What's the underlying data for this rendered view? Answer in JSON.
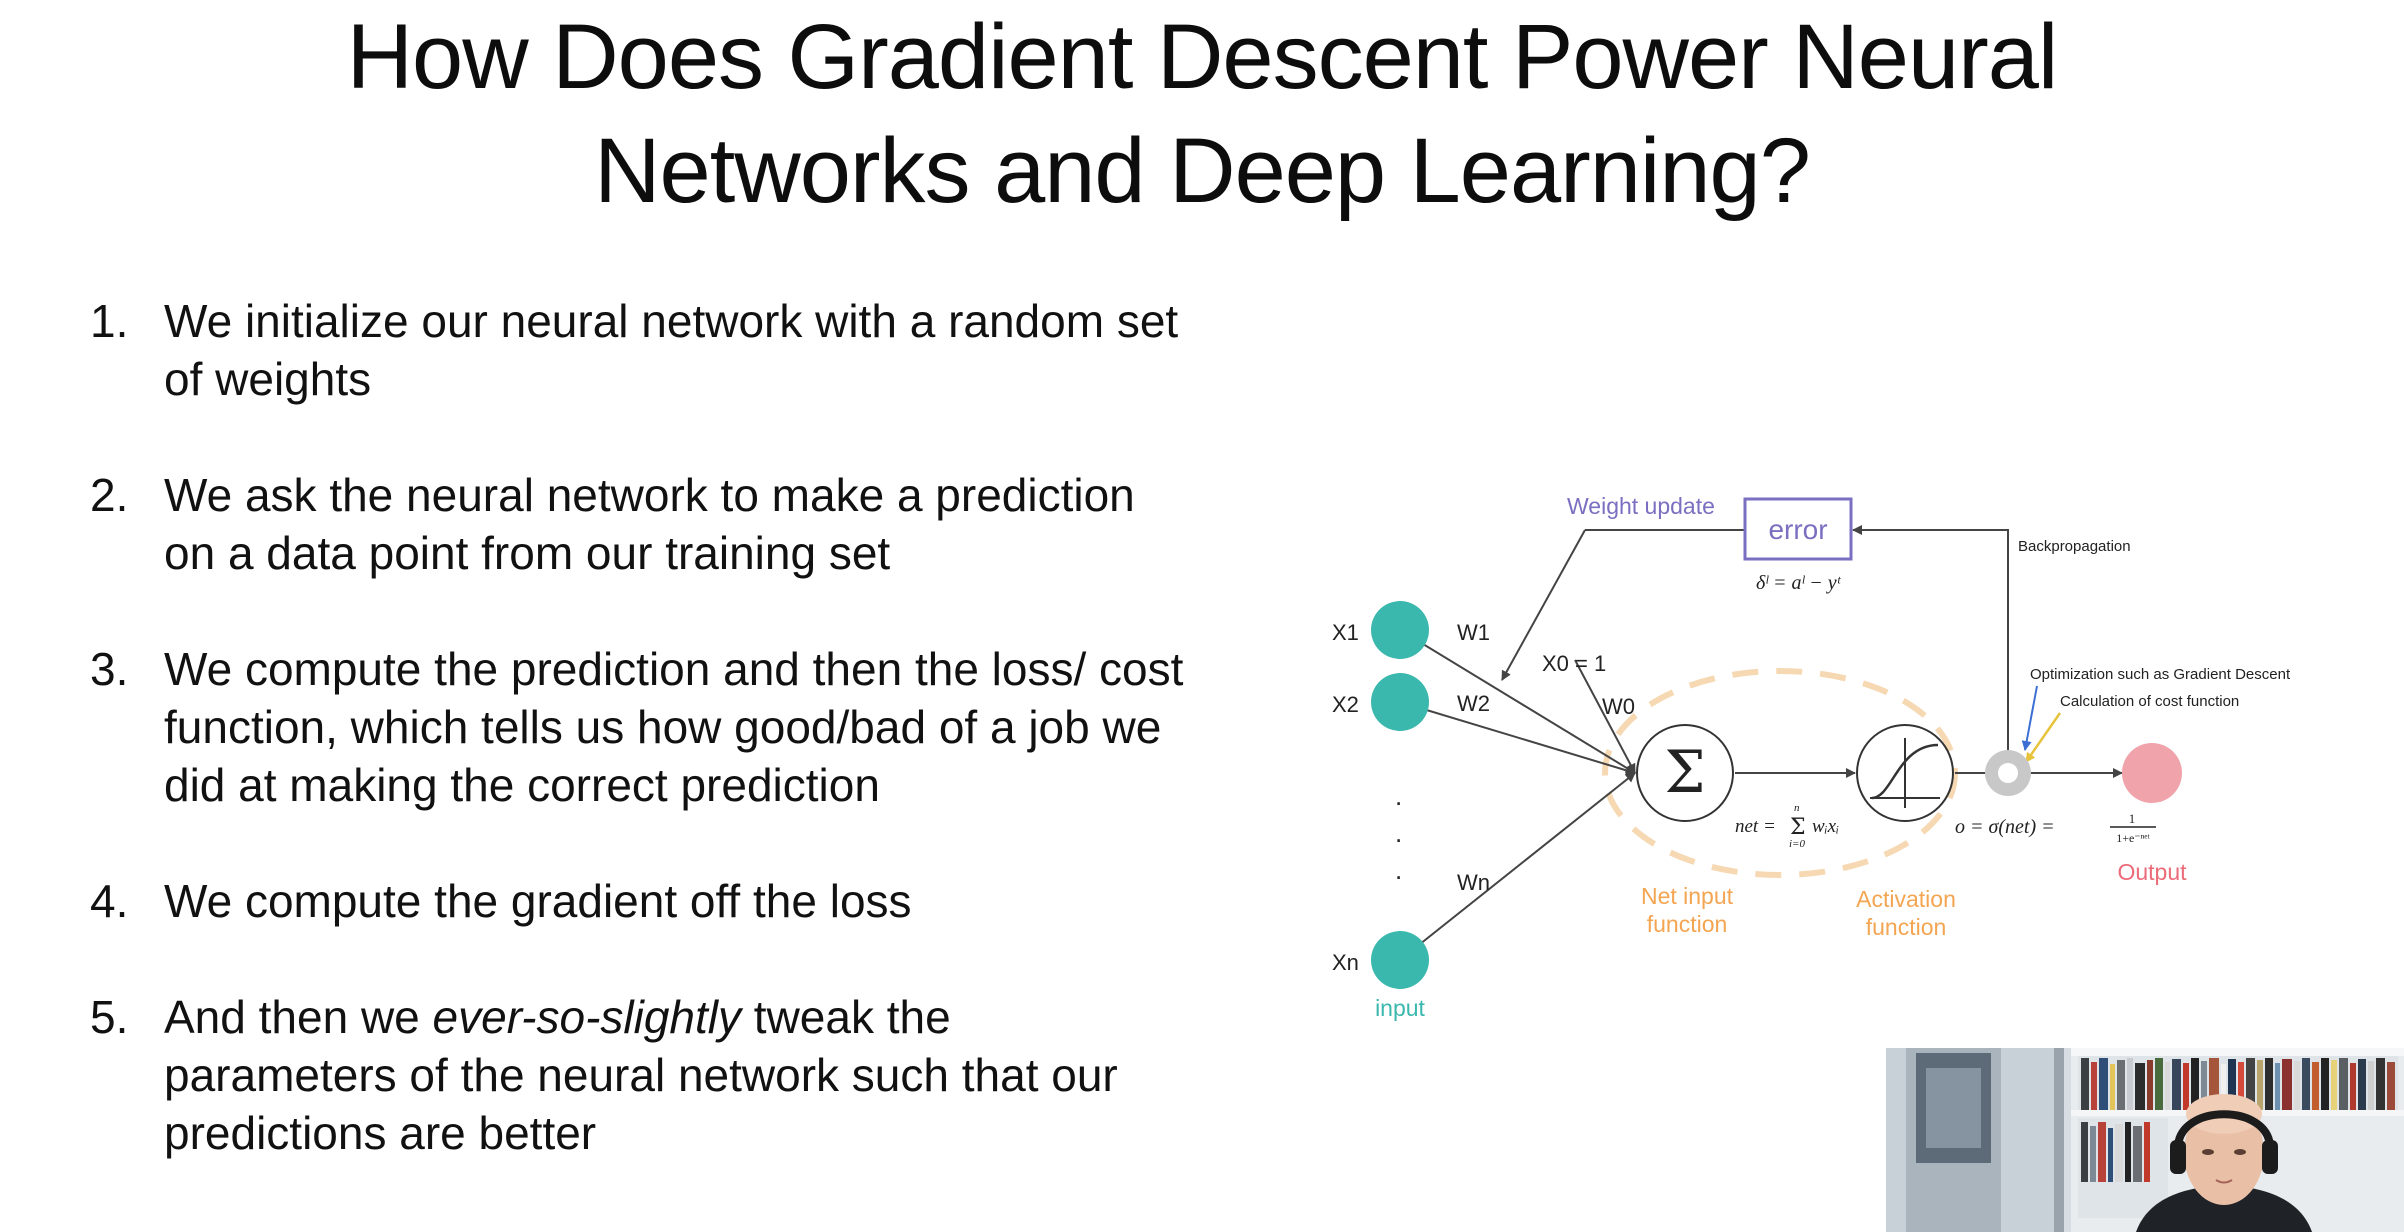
{
  "title": {
    "line1": "How Does Gradient Descent Power Neural",
    "line2": "Networks and Deep Learning?"
  },
  "steps": [
    {
      "number": "1.",
      "text": "We initialize our neural network with a random set of weights"
    },
    {
      "number": "2.",
      "text": "We ask the neural network to make a prediction on a data point from our training set"
    },
    {
      "number": "3.",
      "text": "We compute the prediction and then the loss/ cost function, which tells us how good/bad of a job we did at making the correct prediction"
    },
    {
      "number": "4.",
      "text": "We compute the gradient off the loss"
    },
    {
      "number": "5.",
      "text_before": "And then we ",
      "text_emphasis": "ever-so-slightly",
      "text_after": " tweak the parameters of the neural network such that our predictions are better"
    }
  ],
  "diagram": {
    "inputs": [
      "X1",
      "X2",
      "Xn"
    ],
    "input_caption": "input",
    "dots": ".",
    "weights": [
      "W1",
      "W2",
      "Wn"
    ],
    "bias_input": "X0 = 1",
    "bias_weight": "W0",
    "weight_update": "Weight update",
    "error_label": "error",
    "error_formula": "δˡ = aˡ − yᵗ",
    "backprop": "Backpropagation",
    "optimization": "Optimization such as Gradient Descent",
    "cost_calc": "Calculation of cost function",
    "sum_symbol": "Σ",
    "net_input_line1": "Net input",
    "net_input_line2": "function",
    "activation_line1": "Activation",
    "activation_line2": "function",
    "net_formula_lhs": "net  =",
    "net_formula_sum": "Σ",
    "net_formula_top": "n",
    "net_formula_bottom": "i=0",
    "net_formula_rhs": "wᵢxᵢ",
    "output_formula": "o  =  σ(net)  =",
    "sigmoid_numerator": "1",
    "sigmoid_denominator": "1+e⁻ⁿᵉᵗ",
    "output_label": "Output",
    "colors": {
      "input_node": "#3bb8ad",
      "output_node": "#f0a3aa",
      "error_box": "#7a6fc0",
      "orange_text": "#f3a551",
      "orange_dash": "#f6d9b3",
      "arrow": "#444444",
      "blue_arrow": "#3b6fd4",
      "yellow_arrow": "#e6c33a"
    }
  }
}
